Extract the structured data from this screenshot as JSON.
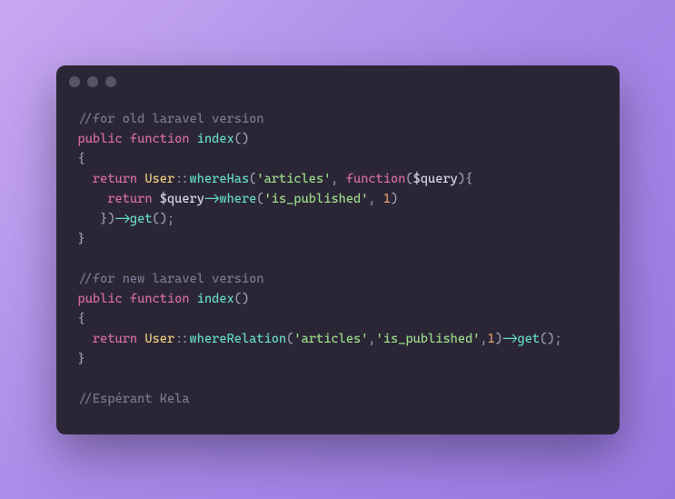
{
  "code": {
    "line1_comment": "//for old laravel version",
    "line2_public": "public",
    "line2_function": "function",
    "line2_name": "index",
    "line2_parens": "()",
    "line3_brace": "{",
    "line4_return": "return",
    "line4_class": "User",
    "line4_scope": "::",
    "line4_method": "whereHas",
    "line4_open": "(",
    "line4_str": "'articles'",
    "line4_comma": ", ",
    "line4_funckey": "function",
    "line4_funcargs_open": "(",
    "line4_var": "$query",
    "line4_funcargs_close": "){",
    "line5_return": "return",
    "line5_var": "$query",
    "line5_arrow": "->",
    "line5_method": "where",
    "line5_open": "(",
    "line5_str": "'is_published'",
    "line5_comma": ", ",
    "line5_num": "1",
    "line5_close": ")",
    "line6_close": "})",
    "line6_arrow": "->",
    "line6_get": "get",
    "line6_parens": "();",
    "line7_brace": "}",
    "line9_comment": "//for new laravel version",
    "line10_public": "public",
    "line10_function": "function",
    "line10_name": "index",
    "line10_parens": "()",
    "line11_brace": "{",
    "line12_return": "return",
    "line12_class": "User",
    "line12_scope": "::",
    "line12_method": "whereRelation",
    "line12_open": "(",
    "line12_str1": "'articles'",
    "line12_comma1": ",",
    "line12_str2": "'is_published'",
    "line12_comma2": ",",
    "line12_num": "1",
    "line12_close": ")",
    "line12_arrow": "->",
    "line12_get": "get",
    "line12_parens2": "();",
    "line13_brace": "}",
    "line15_comment": "//Espérant Kela"
  }
}
